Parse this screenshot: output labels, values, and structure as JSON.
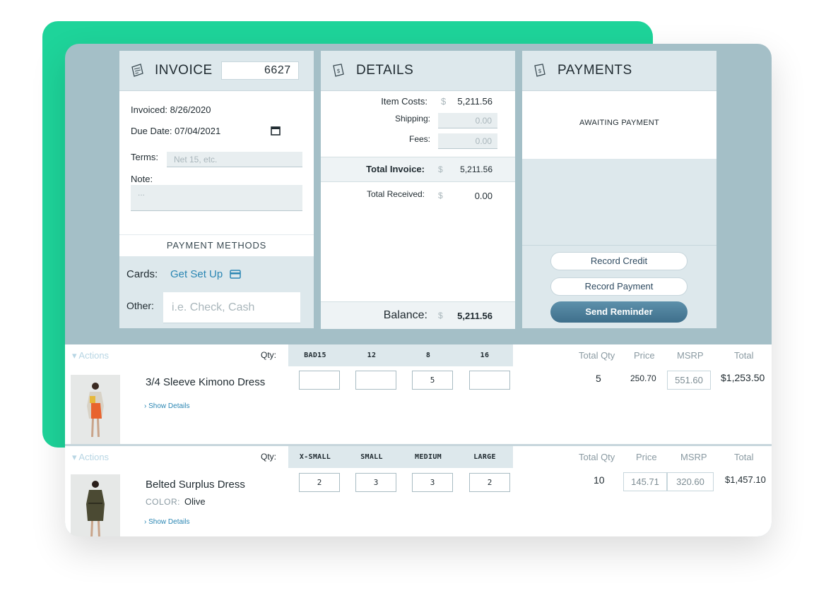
{
  "invoice": {
    "title": "INVOICE",
    "number": "6627",
    "invoiced": "Invoiced: 8/26/2020",
    "due_date": "Due Date: 07/04/2021",
    "terms_label": "Terms:",
    "terms_placeholder": "Net 15, etc.",
    "note_label": "Note:",
    "note_placeholder": "...",
    "payment_methods": "PAYMENT METHODS",
    "cards_label": "Cards:",
    "cards_link": "Get Set Up",
    "other_label": "Other:",
    "other_placeholder": "i.e. Check, Cash"
  },
  "details": {
    "title": "DETAILS",
    "item_costs_label": "Item Costs:",
    "item_costs_value": "5,211.56",
    "shipping_label": "Shipping:",
    "shipping_value": "0.00",
    "fees_label": "Fees:",
    "fees_value": "0.00",
    "total_invoice_label": "Total Invoice:",
    "total_invoice_value": "5,211.56",
    "total_received_label": "Total Received:",
    "total_received_value": "0.00",
    "balance_label": "Balance:",
    "balance_value": "5,211.56",
    "currency": "$"
  },
  "payments": {
    "title": "PAYMENTS",
    "status": "AWAITING PAYMENT",
    "record_credit": "Record Credit",
    "record_payment": "Record Payment",
    "send_reminder": "Send Reminder"
  },
  "columns": {
    "actions": "Actions",
    "qty": "Qty:",
    "total_qty": "Total Qty",
    "price": "Price",
    "msrp": "MSRP",
    "total": "Total"
  },
  "products": [
    {
      "sizes": [
        "BAD15",
        "12",
        "8",
        "16"
      ],
      "quantities": [
        "",
        "",
        "5",
        ""
      ],
      "name": "3/4 Sleeve Kimono Dress",
      "color_label": "",
      "color": "",
      "show_details": "Show Details",
      "total_qty": "5",
      "price": "250.70",
      "msrp": "551.60",
      "total": "$1,253.50"
    },
    {
      "sizes": [
        "X-SMALL",
        "SMALL",
        "MEDIUM",
        "LARGE"
      ],
      "quantities": [
        "2",
        "3",
        "3",
        "2"
      ],
      "name": "Belted Surplus Dress",
      "color_label": "COLOR:",
      "color": "Olive",
      "show_details": "Show Details",
      "total_qty": "10",
      "price": "145.71",
      "msrp": "320.60",
      "total": "$1,457.10"
    }
  ],
  "colors": {
    "accent_green": "#1ed49a",
    "frame": "#a4bfc7",
    "link": "#2a86b3",
    "button_blue": "#4a7e9a"
  }
}
